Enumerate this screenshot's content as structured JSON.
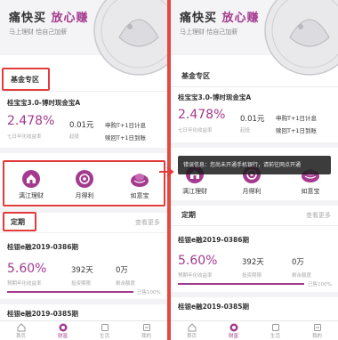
{
  "banner": {
    "title": "痛快买",
    "title_accent": "放心赚",
    "subtitle": "马上理财 恰自己加薪"
  },
  "fund_section": {
    "title": "基金专区"
  },
  "fund_product": {
    "name": "桂宝宝3.0-博时现金宝A",
    "rate": "2.478%",
    "rate_label": "七日年化收益率",
    "min_amount": "0.01元",
    "min_label": "起投",
    "rules": [
      "申购T+1日计息",
      "赎回T+1日到账"
    ]
  },
  "quick_icons": [
    {
      "label": "漓江理财",
      "icon": "house-icon"
    },
    {
      "label": "月得利",
      "icon": "coin-icon"
    },
    {
      "label": "如意宝",
      "icon": "gem-icon"
    }
  ],
  "term_section": {
    "title": "定期",
    "more": "查看更多"
  },
  "term_products": [
    {
      "name": "桂银e融2019-0386期",
      "rate": "5.60%",
      "rate_label": "预期年化收益率",
      "period": "392天",
      "period_label": "投资期限",
      "remaining": "0万",
      "remaining_label": "剩余额度",
      "progress": 1.0,
      "progress_text": "已售100%"
    },
    {
      "name": "桂银e融2019-0385期"
    }
  ],
  "tabs": [
    {
      "label": "首页",
      "icon": "home-icon"
    },
    {
      "label": "财富",
      "icon": "wealth-icon",
      "active": true
    },
    {
      "label": "生活",
      "icon": "life-icon"
    },
    {
      "label": "我的",
      "icon": "profile-icon"
    }
  ],
  "toast": {
    "text": "错误信息：您尚未开通手机银行，请前往网点开通"
  },
  "colors": {
    "accent": "#a33a8e",
    "highlight": "#e23b3b",
    "divider": "#e5483f"
  }
}
